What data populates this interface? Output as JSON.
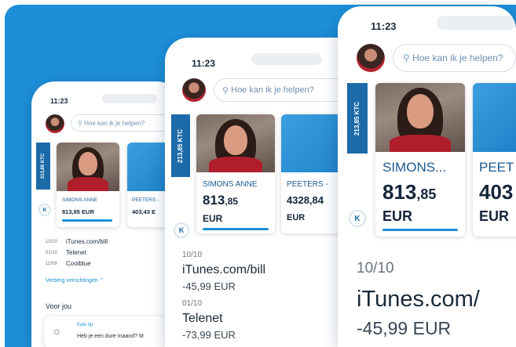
{
  "app": {
    "time": "11:23",
    "search_placeholder": "Hoe kan ik je helpen?",
    "account_tab": "213,85 KTC",
    "accounts": [
      {
        "name": "SIMONS ANNE",
        "name_short": "SIMONS...",
        "amount_int": "813",
        "amount_dec": ",85",
        "amount_small": "813,85 EUR",
        "currency": "EUR"
      },
      {
        "name": "PEETERS -",
        "name_short": "PEET",
        "amount": "4328,84",
        "amount_small": "403,43 E",
        "amount_short": "403",
        "currency": "EUR"
      }
    ],
    "transactions": [
      {
        "date": "10/10",
        "merchant": "iTunes.com/bill",
        "merchant_short": "iTunes.com/",
        "amount": "-45,99 EUR"
      },
      {
        "date": "01/10",
        "merchant": "Telenet",
        "amount": "-73,99 EUR"
      },
      {
        "date": "11/09",
        "merchant": "Coolblue"
      }
    ],
    "hide_transactions": "Verberg verrichtingen",
    "section_title": "Voor jou",
    "tip_title": "Kate tip",
    "tip_text": "Heb je een dure maand? M",
    "k_label": "K"
  }
}
